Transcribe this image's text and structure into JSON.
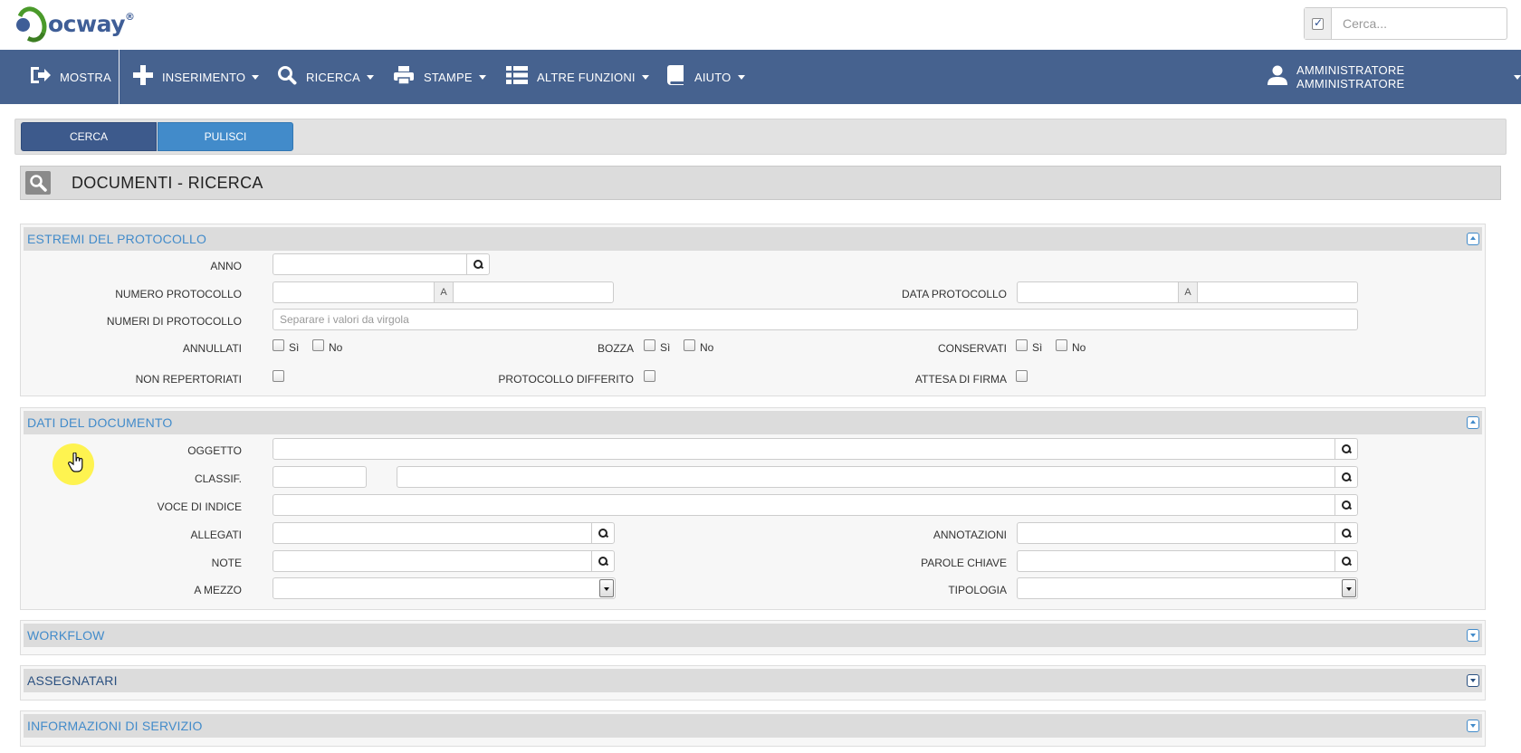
{
  "app": {
    "logo_text": "ocway",
    "logo_reg": "®",
    "quick_search_placeholder": "Cerca..."
  },
  "nav": {
    "mostra": "MOSTRA",
    "inserimento": "INSERIMENTO",
    "ricerca": "RICERCA",
    "stampe": "STAMPE",
    "altre_funzioni": "ALTRE FUNZIONI",
    "aiuto": "AIUTO",
    "user": "AMMINISTRATORE AMMINISTRATORE"
  },
  "toolbar": {
    "cerca": "CERCA",
    "pulisci": "PULISCI"
  },
  "page": {
    "title": "DOCUMENTI - RICERCA"
  },
  "sections": {
    "estremi": {
      "title": "ESTREMI DEL PROTOCOLLO",
      "anno": "ANNO",
      "numero_protocollo": "NUMERO PROTOCOLLO",
      "range_sep": "A",
      "data_protocollo": "DATA PROTOCOLLO",
      "numeri_protocollo": "NUMERI DI PROTOCOLLO",
      "numeri_placeholder": "Separare i valori da virgola",
      "annullati": "ANNULLATI",
      "bozza": "BOZZA",
      "conservati": "CONSERVATI",
      "si": "Sì",
      "no": "No",
      "non_repertoriati": "NON REPERTORIATI",
      "protocollo_differito": "PROTOCOLLO DIFFERITO",
      "attesa_firma": "ATTESA DI FIRMA"
    },
    "dati": {
      "title": "DATI DEL DOCUMENTO",
      "oggetto": "OGGETTO",
      "classif": "CLASSIF.",
      "voce_indice": "VOCE DI INDICE",
      "allegati": "ALLEGATI",
      "annotazioni": "ANNOTAZIONI",
      "note": "NOTE",
      "parole_chiave": "PAROLE CHIAVE",
      "a_mezzo": "A MEZZO",
      "tipologia": "TIPOLOGIA"
    },
    "workflow": {
      "title": "WORKFLOW"
    },
    "assegnatari": {
      "title": "ASSEGNATARI"
    },
    "informazioni": {
      "title": "INFORMAZIONI DI SERVIZIO"
    }
  },
  "colors": {
    "nav_bg": "#46628f",
    "btn_primary": "#3d5a8c",
    "btn_info": "#428bca",
    "section_title": "#428bca"
  }
}
